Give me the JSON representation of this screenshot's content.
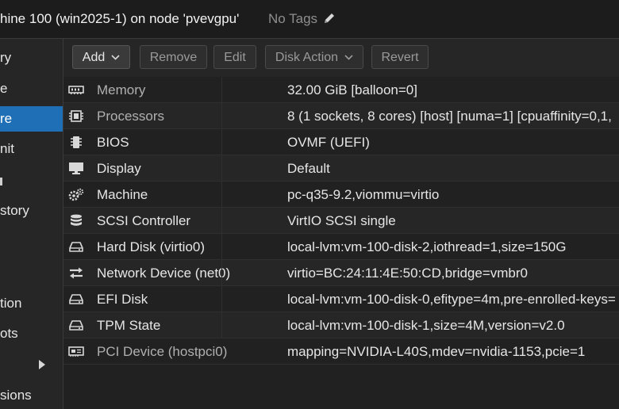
{
  "header": {
    "title": "hine 100 (win2025-1) on node 'pvevgpu'",
    "tags": "No Tags"
  },
  "sidebar": {
    "items": [
      {
        "label": "ry"
      },
      {
        "label": "e"
      },
      {
        "label": "re"
      },
      {
        "label": "nit"
      },
      {
        "label": ""
      },
      {
        "label": "story"
      },
      {
        "label": ""
      },
      {
        "label": ""
      },
      {
        "label": "tion"
      },
      {
        "label": "ots"
      },
      {
        "label": ""
      },
      {
        "label": "sions"
      }
    ],
    "active_index": 2
  },
  "toolbar": {
    "add": "Add",
    "remove": "Remove",
    "edit": "Edit",
    "disk_action": "Disk Action",
    "revert": "Revert"
  },
  "hardware": [
    {
      "icon": "memory-icon",
      "key": "Memory",
      "value": "32.00 GiB [balloon=0]",
      "dim": true
    },
    {
      "icon": "cpu-icon",
      "key": "Processors",
      "value": "8 (1 sockets, 8 cores) [host] [numa=1] [cpuaffinity=0,1,",
      "dim": true
    },
    {
      "icon": "bios-chip-icon",
      "key": "BIOS",
      "value": "OVMF (UEFI)",
      "dim": false
    },
    {
      "icon": "monitor-icon",
      "key": "Display",
      "value": "Default",
      "dim": false
    },
    {
      "icon": "cogs-icon",
      "key": "Machine",
      "value": "pc-q35-9.2,viommu=virtio",
      "dim": false
    },
    {
      "icon": "database-icon",
      "key": "SCSI Controller",
      "value": "VirtIO SCSI single",
      "dim": false
    },
    {
      "icon": "hdd-icon",
      "key": "Hard Disk (virtio0)",
      "value": "local-lvm:vm-100-disk-2,iothread=1,size=150G",
      "dim": false
    },
    {
      "icon": "exchange-icon",
      "key": "Network Device (net0)",
      "value": "virtio=BC:24:11:4E:50:CD,bridge=vmbr0",
      "dim": false
    },
    {
      "icon": "hdd-icon",
      "key": "EFI Disk",
      "value": "local-lvm:vm-100-disk-0,efitype=4m,pre-enrolled-keys=",
      "dim": false
    },
    {
      "icon": "hdd-icon",
      "key": "TPM State",
      "value": "local-lvm:vm-100-disk-1,size=4M,version=v2.0",
      "dim": false
    },
    {
      "icon": "pci-card-icon",
      "key": "PCI Device (hostpci0)",
      "value": "mapping=NVIDIA-L40S,mdev=nvidia-1153,pcie=1",
      "dim": true
    }
  ],
  "colors": {
    "accent": "#1f6fb6",
    "background": "#212121",
    "text": "#e6e6e6"
  }
}
